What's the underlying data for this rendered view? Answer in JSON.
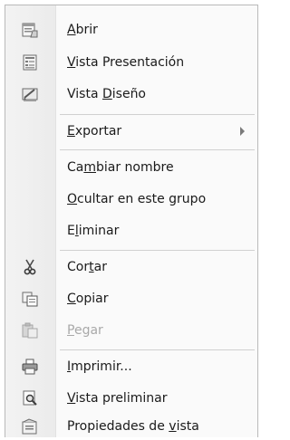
{
  "menu": {
    "items": [
      {
        "id": "abrir",
        "pre": "",
        "u": "A",
        "post": "brir",
        "icon": "open-form-icon"
      },
      {
        "id": "vista-presentacion",
        "pre": "",
        "u": "V",
        "post": "ista Presentación",
        "icon": "layout-view-icon"
      },
      {
        "id": "vista-diseno",
        "pre": "Vista ",
        "u": "D",
        "post": "iseño",
        "icon": "design-view-icon"
      },
      {
        "id": "exportar",
        "pre": "",
        "u": "E",
        "post": "xportar",
        "icon": ""
      },
      {
        "id": "cambiar-nombre",
        "pre": "Ca",
        "u": "m",
        "post": "biar nombre",
        "icon": ""
      },
      {
        "id": "ocultar",
        "pre": "",
        "u": "O",
        "post": "cultar en este grupo",
        "icon": ""
      },
      {
        "id": "eliminar",
        "pre": "E",
        "u": "l",
        "post": "iminar",
        "icon": ""
      },
      {
        "id": "cortar",
        "pre": "Cor",
        "u": "t",
        "post": "ar",
        "icon": "scissors-icon"
      },
      {
        "id": "copiar",
        "pre": "",
        "u": "C",
        "post": "opiar",
        "icon": "copy-icon"
      },
      {
        "id": "pegar",
        "pre": "",
        "u": "P",
        "post": "egar",
        "icon": "paste-icon"
      },
      {
        "id": "imprimir",
        "pre": "",
        "u": "I",
        "post": "mprimir...",
        "icon": "printer-icon"
      },
      {
        "id": "vista-preliminar",
        "pre": "",
        "u": "V",
        "post": "ista preliminar",
        "icon": "print-preview-icon"
      },
      {
        "id": "propiedades",
        "pre": "Propiedades de ",
        "u": "v",
        "post": "ista",
        "icon": "properties-icon"
      }
    ]
  },
  "colors": {
    "text": "#1a1a1a",
    "disabled": "#a9a9a9",
    "separator": "#d0d0d0"
  }
}
